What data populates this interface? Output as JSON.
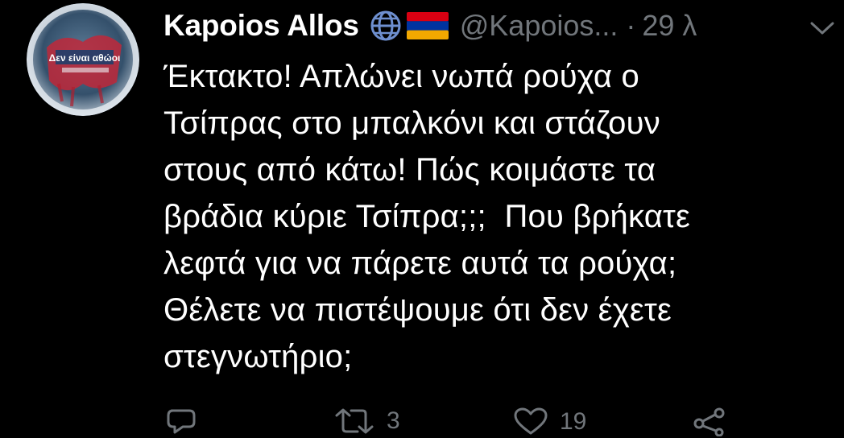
{
  "tweet": {
    "display_name": "Kapoios Allos",
    "handle": "@Kapoios...",
    "separator": "·",
    "timestamp": "29 λ",
    "body_lines": [
      "Έκτακτο! Απλώνει νωπά ρούχα ο",
      "Τσίπρας στο μπαλκόνι και στάζουν",
      "στους από κάτω! Πώς κοιμάστε τα",
      "βράδια κύριε Τσίπρα;;;  Που βρήκατε",
      "λεφτά για να πάρετε αυτά τα ρούχα;",
      "Θέλετε να πιστέψουμε ότι δεν έχετε",
      "στεγνωτήριο;"
    ],
    "avatar_text": "Δεν είναι αθώοι",
    "icons": {
      "verified_globe": "globe-icon",
      "flag": "armenia-flag-icon",
      "menu": "chevron-down-icon"
    }
  },
  "actions": {
    "reply": {
      "icon": "reply-icon",
      "count": ""
    },
    "retweet": {
      "icon": "retweet-icon",
      "count": "3"
    },
    "like": {
      "icon": "heart-icon",
      "count": "19"
    },
    "share": {
      "icon": "share-icon",
      "count": ""
    }
  },
  "colors": {
    "background": "#000000",
    "text": "#ffffff",
    "secondary": "#71767b",
    "flag_red": "#d90012",
    "flag_blue": "#0033a0",
    "flag_orange": "#f2a800"
  }
}
